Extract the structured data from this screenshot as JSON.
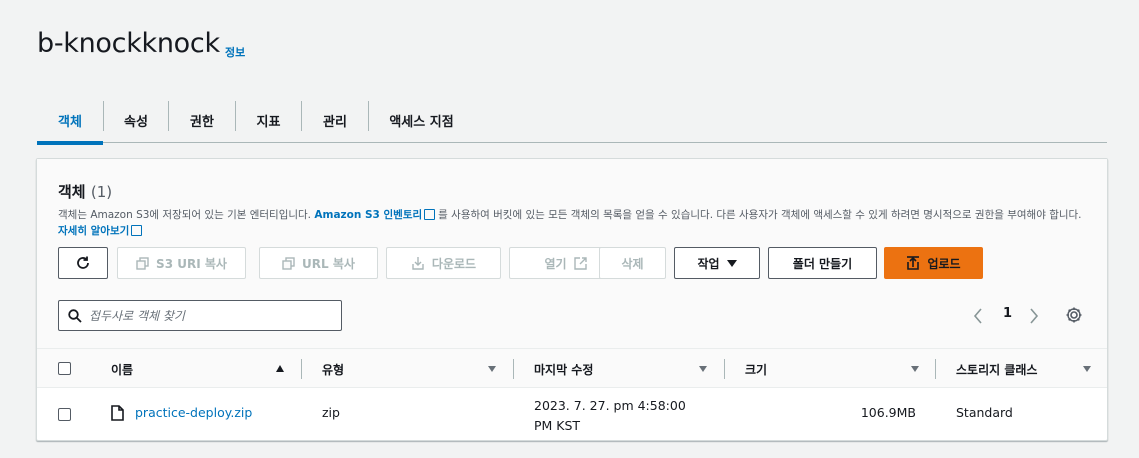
{
  "bucket": {
    "name": "b-knockknock",
    "info_link": "정보"
  },
  "tabs": [
    "객체",
    "속성",
    "권한",
    "지표",
    "관리",
    "액세스 지점"
  ],
  "objects_panel": {
    "title": "객체",
    "count": "(1)",
    "description_1": "객체는 Amazon S3에 저장되어 있는 기본 엔터티입니다. ",
    "inventory_link": "Amazon S3 인벤토리",
    "description_2": "를 사용하여 버킷에 있는 모든 객체의 목록을 얻을 수 있습니다. 다른 사용자가 객체에 액세스할 수 있게 하려면 명시적으로 권한을 부여해야 합니다. ",
    "learn_more_link": "자세히 알아보기"
  },
  "toolbar": {
    "s3_uri_copy": "S3 URI 복사",
    "url_copy": "URL 복사",
    "download": "다운로드",
    "open": "열기",
    "delete": "삭제",
    "actions": "작업",
    "create_folder": "폴더 만들기",
    "upload": "업로드"
  },
  "search": {
    "placeholder": "접두사로 객체 찾기"
  },
  "pagination": {
    "page": "1"
  },
  "table": {
    "headers": {
      "name": "이름",
      "type": "유형",
      "last_modified": "마지막 수정",
      "size": "크기",
      "storage_class": "스토리지 클래스"
    },
    "rows": [
      {
        "name": "practice-deploy.zip",
        "type": "zip",
        "last_modified_line1": "2023. 7. 27. pm 4:58:00",
        "last_modified_line2": "PM KST",
        "size": "106.9MB",
        "storage_class": "Standard"
      }
    ]
  },
  "colors": {
    "link": "#0073bb",
    "primary": "#ec7211",
    "background": "#f2f3f3"
  }
}
